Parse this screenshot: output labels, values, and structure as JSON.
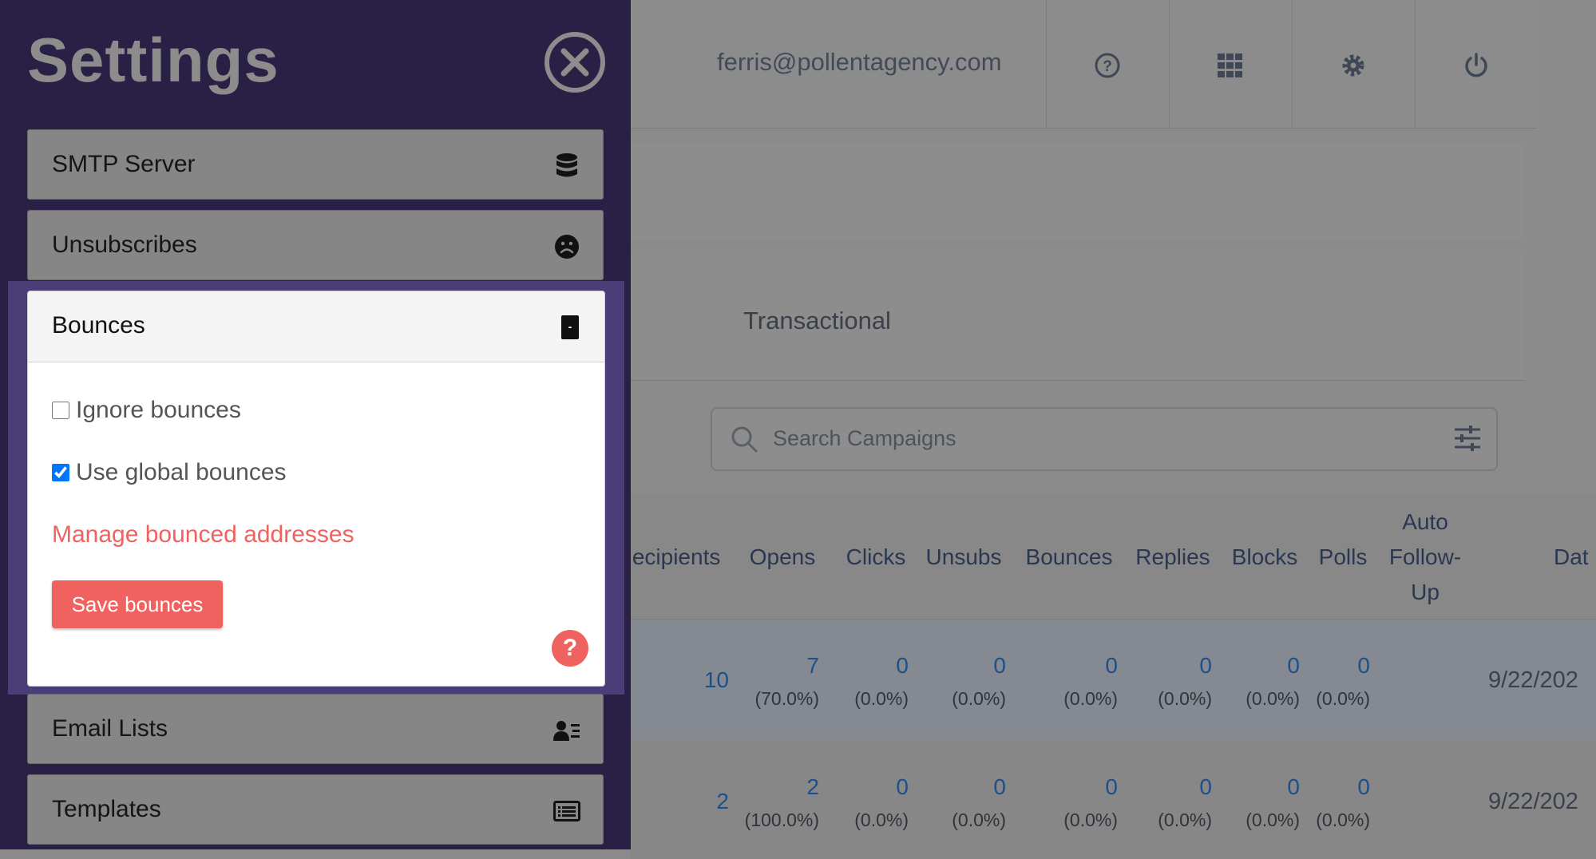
{
  "header": {
    "email": "ferris@pollentagency.com",
    "icons": [
      "help-circle-icon",
      "apps-grid-icon",
      "gear-icon",
      "power-icon"
    ]
  },
  "tabs": {
    "transactional": "Transactional"
  },
  "search": {
    "placeholder": "Search Campaigns"
  },
  "table": {
    "headers": [
      "Recipients",
      "Opens",
      "Clicks",
      "Unsubs",
      "Bounces",
      "Replies",
      "Blocks",
      "Polls",
      "Auto Follow-Up",
      "Dat"
    ],
    "rows": [
      {
        "recipients": "10",
        "opens": "7",
        "opens_pct": "(70.0%)",
        "clicks": "0",
        "clicks_pct": "(0.0%)",
        "unsubs": "0",
        "unsubs_pct": "(0.0%)",
        "bounces": "0",
        "bounces_pct": "(0.0%)",
        "replies": "0",
        "replies_pct": "(0.0%)",
        "blocks": "0",
        "blocks_pct": "(0.0%)",
        "polls": "0",
        "polls_pct": "(0.0%)",
        "date": "9/22/202"
      },
      {
        "recipients": "2",
        "opens": "2",
        "opens_pct": "(100.0%)",
        "clicks": "0",
        "clicks_pct": "(0.0%)",
        "unsubs": "0",
        "unsubs_pct": "(0.0%)",
        "bounces": "0",
        "bounces_pct": "(0.0%)",
        "replies": "0",
        "replies_pct": "(0.0%)",
        "blocks": "0",
        "blocks_pct": "(0.0%)",
        "polls": "0",
        "polls_pct": "(0.0%)",
        "date": "9/22/202"
      }
    ]
  },
  "settings": {
    "title": "Settings",
    "sections": [
      {
        "label": "SMTP Server",
        "icon": "database-icon"
      },
      {
        "label": "Unsubscribes",
        "icon": "sad-face-icon"
      },
      {
        "label": "Bounces",
        "icon": "minus-box-icon"
      },
      {
        "label": "Email Lists",
        "icon": "user-list-icon"
      },
      {
        "label": "Templates",
        "icon": "template-list-icon"
      }
    ],
    "bounces": {
      "ignore_label": "Ignore bounces",
      "ignore_checked": false,
      "global_label": "Use global bounces",
      "global_checked": true,
      "manage_link": "Manage bounced addresses",
      "save_label": "Save bounces",
      "help": "?"
    }
  },
  "colors": {
    "drawer": "#2a1f44",
    "highlight": "#4a3d78",
    "accent": "#f0625f",
    "link_blue": "#1d4f88"
  }
}
